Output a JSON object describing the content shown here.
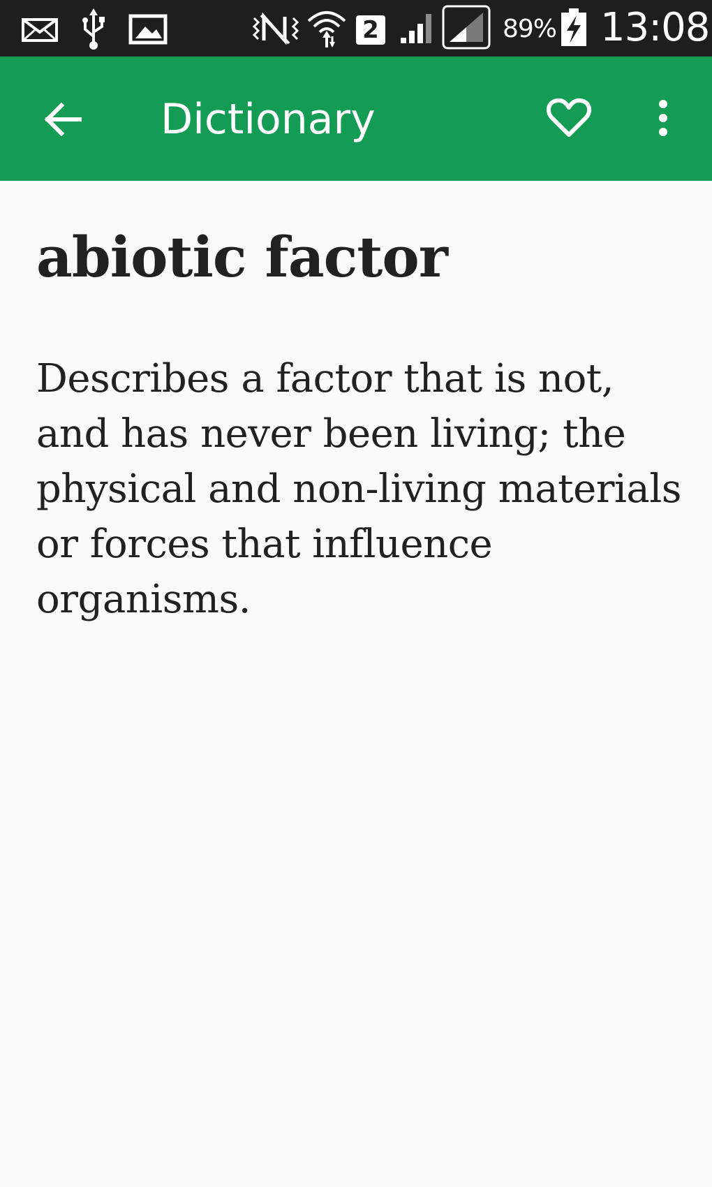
{
  "status_bar": {
    "icons": [
      "mail-icon",
      "usb-icon",
      "gallery-icon",
      "nfc-icon",
      "wifi-icon",
      "sim-2-icon",
      "signal-icon",
      "signal-icon",
      "battery-charging-icon"
    ],
    "sim_label": "2",
    "battery_percent": "89%",
    "time": "13:08"
  },
  "app_bar": {
    "title": "Dictionary",
    "back_icon": "arrow-left-icon",
    "favorite_icon": "heart-outline-icon",
    "more_icon": "more-vertical-icon",
    "background_color": "#149c55"
  },
  "entry": {
    "term": "abiotic factor",
    "definition": "Describes a factor that is not, and has never been living; the physical and non-living materials or forces that influence organisms."
  }
}
